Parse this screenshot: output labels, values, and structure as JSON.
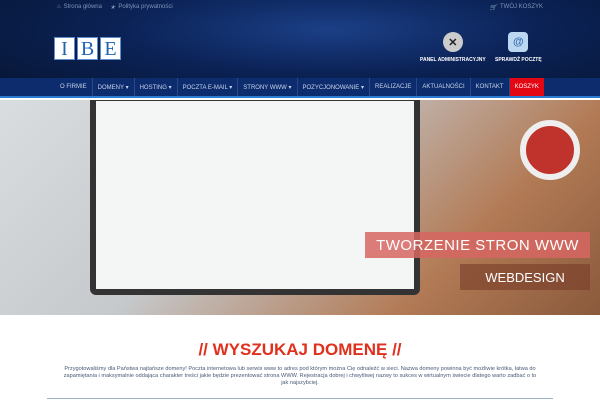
{
  "topbar": {
    "home": "Strona główna",
    "privacy": "Polityka prywatności",
    "cart": "TWÓJ KOSZYK"
  },
  "logo": [
    "I",
    "B",
    "E"
  ],
  "tools": {
    "panel": "PANEL ADMINISTRACYJNY",
    "mail": "SPRAWDŹ POCZTĘ"
  },
  "nav": [
    "O FIRMIE",
    "DOMENY ▾",
    "HOSTING ▾",
    "POCZTA E-MAIL ▾",
    "STRONY WWW ▾",
    "POZYCJONOWANIE ▾",
    "REALIZACJE",
    "AKTUALNOŚCI",
    "KONTAKT",
    "KOSZYK"
  ],
  "hero": {
    "title": "TWORZENIE STRON WWW",
    "subtitle": "WEBDESIGN"
  },
  "domain": {
    "heading": "// WYSZUKAJ DOMENĘ //",
    "text": "Przygotowaliśmy dla Państwa najtańsze domeny! Poczta internetowa lub serwis www to adres pod którym można Cię odnaleźć w sieci. Nazwa domeny powinna być możliwie krótka, łatwa do zapamiętania i maksymalnie oddająca charakter treści jakie będzie prezentować strona WWW. Rejestracja dobrej i chwytliwej nazwy to sukces w wirtualnym świecie dlatego warto zadbać o to jak najszybciej."
  }
}
